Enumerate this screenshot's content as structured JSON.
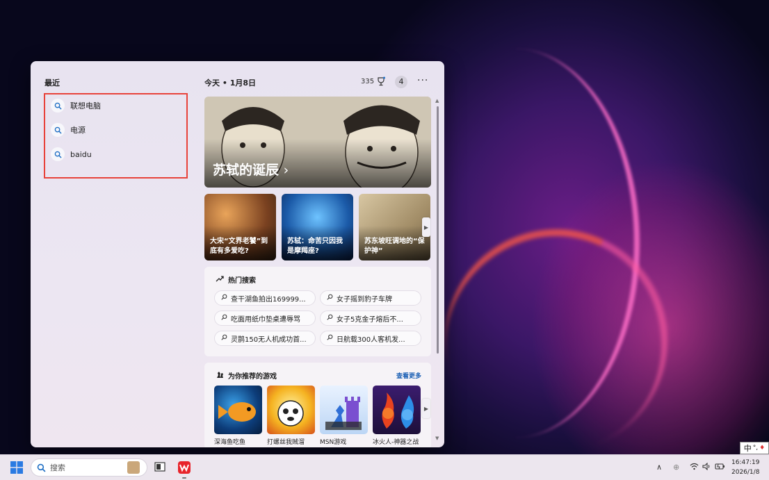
{
  "panel": {
    "recent_title": "最近",
    "recent_items": [
      {
        "label": "联想电脑"
      },
      {
        "label": "电源"
      },
      {
        "label": "baidu"
      }
    ],
    "today_label": "今天",
    "date": "1月8日",
    "points": "335",
    "notification_count": "4",
    "more_label": "···"
  },
  "hero": {
    "title": "苏轼的诞辰"
  },
  "cards": [
    {
      "title": "大宋“文界老饕”到底有多爱吃?"
    },
    {
      "title": "苏轼：命苦只因我是摩羯座?"
    },
    {
      "title": "苏东坡旺调地的“保护神”"
    }
  ],
  "hot": {
    "title": "热门搜索",
    "items": [
      "查干湖鱼拍出169999...",
      "女子摇到豹子车牌",
      "吃面用纸巾垫桌遭辱骂",
      "女子5克金子熔后不...",
      "灵鹊150无人机成功首...",
      "日航载300人客机发..."
    ]
  },
  "games": {
    "title": "为你推荐的游戏",
    "see_more": "查看更多",
    "items": [
      {
        "name": "深海鱼吃鱼"
      },
      {
        "name": "打螺丝我贼溜"
      },
      {
        "name": "MSN游戏"
      },
      {
        "name": "冰火人-神器之战"
      }
    ]
  },
  "ime": {
    "label": "中"
  },
  "taskbar": {
    "search_placeholder": "搜索",
    "time": "16:47:19",
    "date": "2026/1/8"
  },
  "colors": {
    "highlight_border": "#e8423a",
    "link_blue": "#1a5fb4"
  }
}
